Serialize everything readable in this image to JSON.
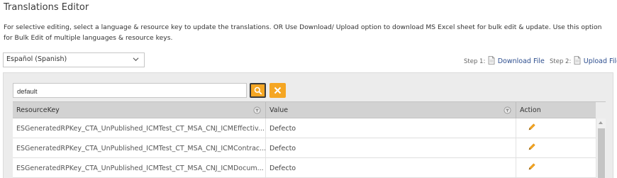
{
  "header": {
    "title": "Translations Editor",
    "description": "For selective editing, select a language & resource key to update the translations. OR Use Download/ Upload option to download MS Excel sheet for bulk edit & update. Use this option for Bulk Edit of multiple languages & resource keys."
  },
  "language_select": {
    "selected": "Español (Spanish)"
  },
  "steps": {
    "step1_label": "Step 1:",
    "download_label": "Download File",
    "step2_label": "Step 2:",
    "upload_label": "Upload File"
  },
  "search": {
    "value": "default"
  },
  "grid": {
    "columns": {
      "resource_key": "ResourceKey",
      "value": "Value",
      "action": "Action"
    },
    "rows": [
      {
        "resource_key": "ESGeneratedRPKey_CTA_UnPublished_ICMTest_CT_MSA_CNJ_ICMEffectiv...",
        "value": "Defecto"
      },
      {
        "resource_key": "ESGeneratedRPKey_CTA_UnPublished_ICMTest_CT_MSA_CNJ_ICMContrac...",
        "value": "Defecto"
      },
      {
        "resource_key": "ESGeneratedRPKey_CTA_UnPublished_ICMTest_CT_MSA_CNJ_ICMDocum...",
        "value": "Defecto"
      }
    ]
  },
  "icons": {
    "search": "search-icon",
    "clear": "close-icon",
    "filter": "filter-icon",
    "edit": "pencil-icon",
    "file": "document-icon",
    "dropdown": "chevron-down-icon"
  },
  "colors": {
    "accent": "#f5a623",
    "link": "#2e4f8f",
    "header_bg": "#d2d2d2",
    "panel_bg": "#ececec"
  }
}
